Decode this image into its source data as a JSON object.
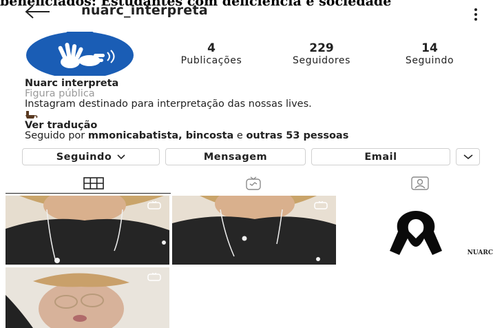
{
  "caption": "beneficiados: Estudantes com deficiência e sociedade",
  "header": {
    "back_icon": "arrow-left-icon",
    "username": "nuarc_interpreta",
    "more_icon": "vertical-dots-icon"
  },
  "profile": {
    "avatar_icon": "sign-language-hands-icon",
    "avatar_color": "#1a5db5",
    "stats": {
      "posts": {
        "value": "4",
        "label": "Publicações"
      },
      "followers": {
        "value": "229",
        "label": "Seguidores"
      },
      "following": {
        "value": "14",
        "label": "Seguindo"
      }
    },
    "bio": {
      "name": "Nuarc interpreta",
      "category": "Figura pública",
      "text": "Instagram destinado para interpretação das nossas lives.",
      "emoji": "coffee-emoji",
      "translate": "Ver tradução",
      "followed_prefix": "Seguido por ",
      "followed_users": "mmonicabatista, bincosta",
      "followed_and": " e ",
      "followed_others": "outras 53 pessoas"
    }
  },
  "actions": {
    "following_label": "Seguindo",
    "message_label": "Mensagem",
    "email_label": "Email"
  },
  "tabs": {
    "grid_icon": "grid-icon",
    "igtv_icon": "igtv-icon",
    "tagged_icon": "tagged-person-icon"
  },
  "posts": {
    "watermark": "NUARC",
    "ribbon_icon": "black-ribbon-icon",
    "video_badge_icon": "igtv-badge-icon"
  }
}
